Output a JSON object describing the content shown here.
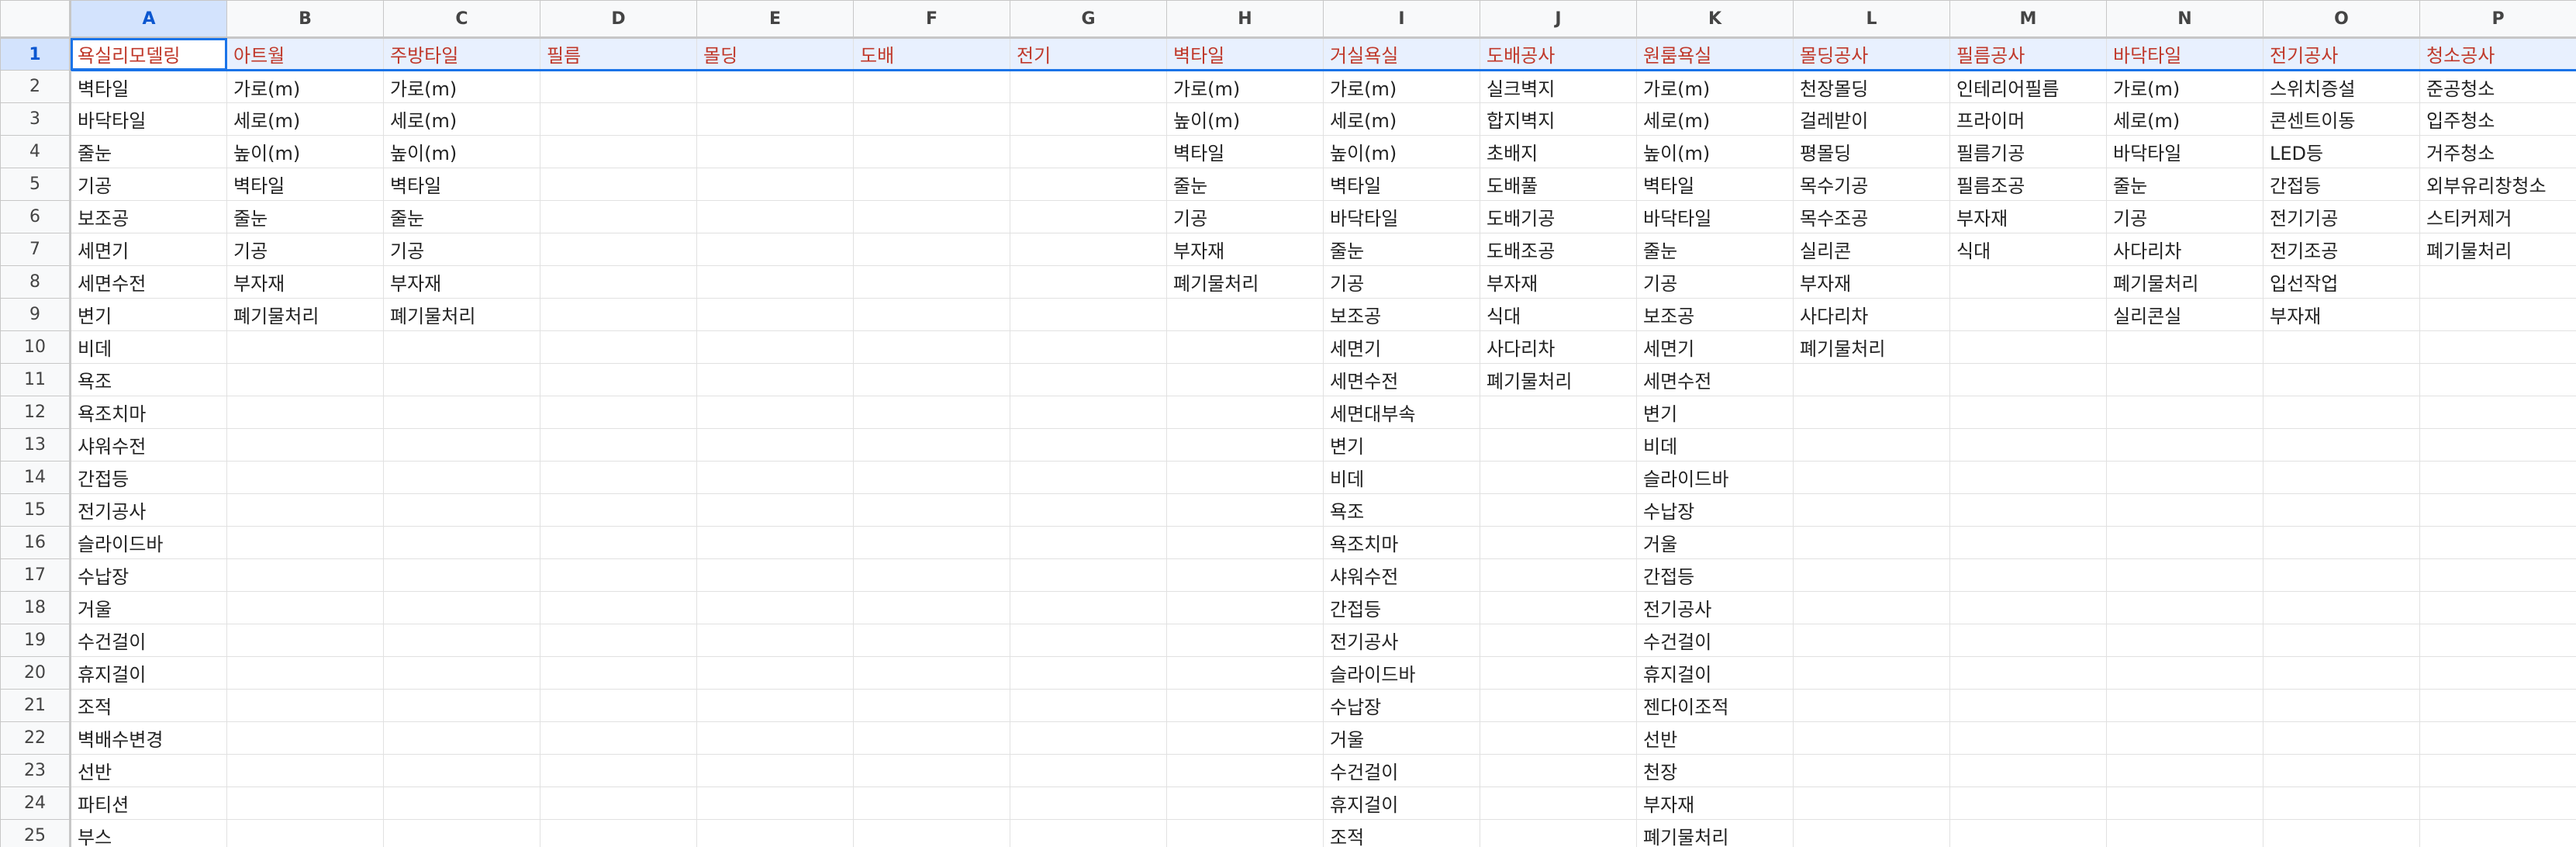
{
  "spreadsheet": {
    "columns": [
      "A",
      "B",
      "C",
      "D",
      "E",
      "F",
      "G",
      "H",
      "I",
      "J",
      "K",
      "L",
      "M",
      "N",
      "O",
      "P"
    ],
    "row_numbers": [
      1,
      2,
      3,
      4,
      5,
      6,
      7,
      8,
      9,
      10,
      11,
      12,
      13,
      14,
      15,
      16,
      17,
      18,
      19,
      20,
      21,
      22,
      23,
      24,
      25
    ],
    "rows": [
      [
        "욕실리모델링",
        "아트월",
        "주방타일",
        "필름",
        "몰딩",
        "도배",
        "전기",
        "벽타일",
        "거실욕실",
        "도배공사",
        "원룸욕실",
        "몰딩공사",
        "필름공사",
        "바닥타일",
        "전기공사",
        "청소공사"
      ],
      [
        "벽타일",
        "가로(m)",
        "가로(m)",
        "",
        "",
        "",
        "",
        "가로(m)",
        "가로(m)",
        "실크벽지",
        "가로(m)",
        "천장몰딩",
        "인테리어필름",
        "가로(m)",
        "스위치증설",
        "준공청소"
      ],
      [
        "바닥타일",
        "세로(m)",
        "세로(m)",
        "",
        "",
        "",
        "",
        "높이(m)",
        "세로(m)",
        "합지벽지",
        "세로(m)",
        "걸레받이",
        "프라이머",
        "세로(m)",
        "콘센트이동",
        "입주청소"
      ],
      [
        "줄눈",
        "높이(m)",
        "높이(m)",
        "",
        "",
        "",
        "",
        "벽타일",
        "높이(m)",
        "초배지",
        "높이(m)",
        "평몰딩",
        "필름기공",
        "바닥타일",
        "LED등",
        "거주청소"
      ],
      [
        "기공",
        "벽타일",
        "벽타일",
        "",
        "",
        "",
        "",
        "줄눈",
        "벽타일",
        "도배풀",
        "벽타일",
        "목수기공",
        "필름조공",
        "줄눈",
        "간접등",
        "외부유리창청소"
      ],
      [
        "보조공",
        "줄눈",
        "줄눈",
        "",
        "",
        "",
        "",
        "기공",
        "바닥타일",
        "도배기공",
        "바닥타일",
        "목수조공",
        "부자재",
        "기공",
        "전기기공",
        "스티커제거"
      ],
      [
        "세면기",
        "기공",
        "기공",
        "",
        "",
        "",
        "",
        "부자재",
        "줄눈",
        "도배조공",
        "줄눈",
        "실리콘",
        "식대",
        "사다리차",
        "전기조공",
        "폐기물처리"
      ],
      [
        "세면수전",
        "부자재",
        "부자재",
        "",
        "",
        "",
        "",
        "폐기물처리",
        "기공",
        "부자재",
        "기공",
        "부자재",
        "",
        "폐기물처리",
        "입선작업",
        ""
      ],
      [
        "변기",
        "폐기물처리",
        "폐기물처리",
        "",
        "",
        "",
        "",
        "",
        "보조공",
        "식대",
        "보조공",
        "사다리차",
        "",
        "실리콘실",
        "부자재",
        ""
      ],
      [
        "비데",
        "",
        "",
        "",
        "",
        "",
        "",
        "",
        "세면기",
        "사다리차",
        "세면기",
        "폐기물처리",
        "",
        "",
        "",
        ""
      ],
      [
        "욕조",
        "",
        "",
        "",
        "",
        "",
        "",
        "",
        "세면수전",
        "폐기물처리",
        "세면수전",
        "",
        "",
        "",
        "",
        ""
      ],
      [
        "욕조치마",
        "",
        "",
        "",
        "",
        "",
        "",
        "",
        "세면대부속",
        "",
        "변기",
        "",
        "",
        "",
        "",
        ""
      ],
      [
        "샤워수전",
        "",
        "",
        "",
        "",
        "",
        "",
        "",
        "변기",
        "",
        "비데",
        "",
        "",
        "",
        "",
        ""
      ],
      [
        "간접등",
        "",
        "",
        "",
        "",
        "",
        "",
        "",
        "비데",
        "",
        "슬라이드바",
        "",
        "",
        "",
        "",
        ""
      ],
      [
        "전기공사",
        "",
        "",
        "",
        "",
        "",
        "",
        "",
        "욕조",
        "",
        "수납장",
        "",
        "",
        "",
        "",
        ""
      ],
      [
        "슬라이드바",
        "",
        "",
        "",
        "",
        "",
        "",
        "",
        "욕조치마",
        "",
        "거울",
        "",
        "",
        "",
        "",
        ""
      ],
      [
        "수납장",
        "",
        "",
        "",
        "",
        "",
        "",
        "",
        "샤워수전",
        "",
        "간접등",
        "",
        "",
        "",
        "",
        ""
      ],
      [
        "거울",
        "",
        "",
        "",
        "",
        "",
        "",
        "",
        "간접등",
        "",
        "전기공사",
        "",
        "",
        "",
        "",
        ""
      ],
      [
        "수건걸이",
        "",
        "",
        "",
        "",
        "",
        "",
        "",
        "전기공사",
        "",
        "수건걸이",
        "",
        "",
        "",
        "",
        ""
      ],
      [
        "휴지걸이",
        "",
        "",
        "",
        "",
        "",
        "",
        "",
        "슬라이드바",
        "",
        "휴지걸이",
        "",
        "",
        "",
        "",
        ""
      ],
      [
        "조적",
        "",
        "",
        "",
        "",
        "",
        "",
        "",
        "수납장",
        "",
        "젠다이조적",
        "",
        "",
        "",
        "",
        ""
      ],
      [
        "벽배수변경",
        "",
        "",
        "",
        "",
        "",
        "",
        "",
        "거울",
        "",
        "선반",
        "",
        "",
        "",
        "",
        ""
      ],
      [
        "선반",
        "",
        "",
        "",
        "",
        "",
        "",
        "",
        "수건걸이",
        "",
        "천장",
        "",
        "",
        "",
        "",
        ""
      ],
      [
        "파티션",
        "",
        "",
        "",
        "",
        "",
        "",
        "",
        "휴지걸이",
        "",
        "부자재",
        "",
        "",
        "",
        "",
        ""
      ],
      [
        "부스",
        "",
        "",
        "",
        "",
        "",
        "",
        "",
        "조적",
        "",
        "폐기물처리",
        "",
        "",
        "",
        "",
        ""
      ]
    ],
    "active_cell": "A1",
    "header_text_color": "#c0392b",
    "selection_color": "#1a73e8"
  }
}
